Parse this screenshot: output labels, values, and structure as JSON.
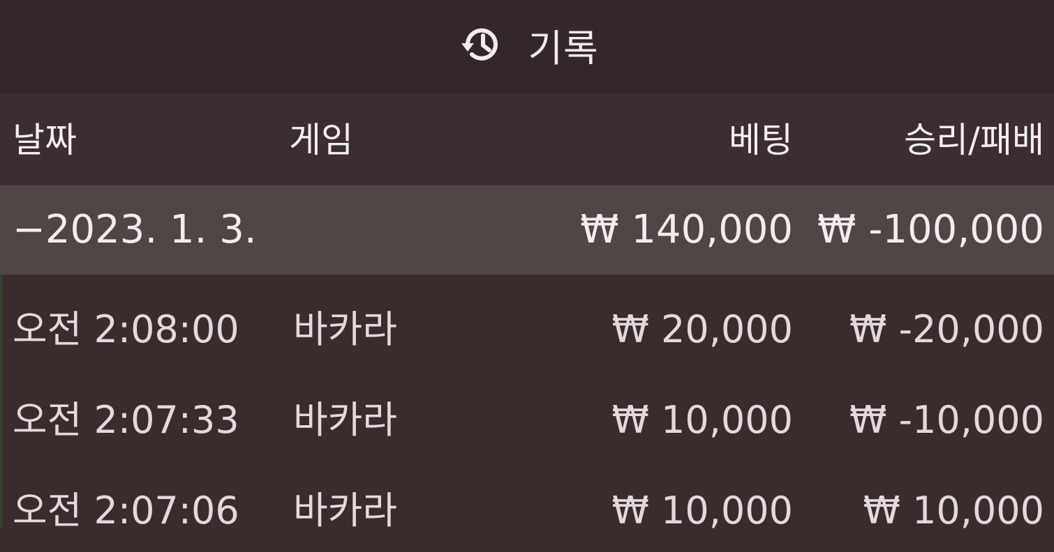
{
  "header": {
    "icon": "history-icon",
    "title": "기록"
  },
  "table": {
    "columns": [
      "날짜",
      "게임",
      "베팅",
      "승리/패배"
    ],
    "group": {
      "date": "−2023. 1. 3.",
      "game": "",
      "bet": "₩ 140,000",
      "result": "₩ -100,000"
    },
    "rows": [
      {
        "time": "오전 2:08:00",
        "game": "바카라",
        "bet": "₩ 20,000",
        "result": "₩ -20,000"
      },
      {
        "time": "오전 2:07:33",
        "game": "바카라",
        "bet": "₩ 10,000",
        "result": "₩ -10,000"
      },
      {
        "time": "오전 2:07:06",
        "game": "바카라",
        "bet": "₩ 10,000",
        "result": "₩ 10,000"
      }
    ]
  },
  "colors": {
    "header_bg": "#332729",
    "body_bg": "#3a2b2d",
    "group_row_bg": "#504646",
    "text": "#ebe4e4"
  }
}
